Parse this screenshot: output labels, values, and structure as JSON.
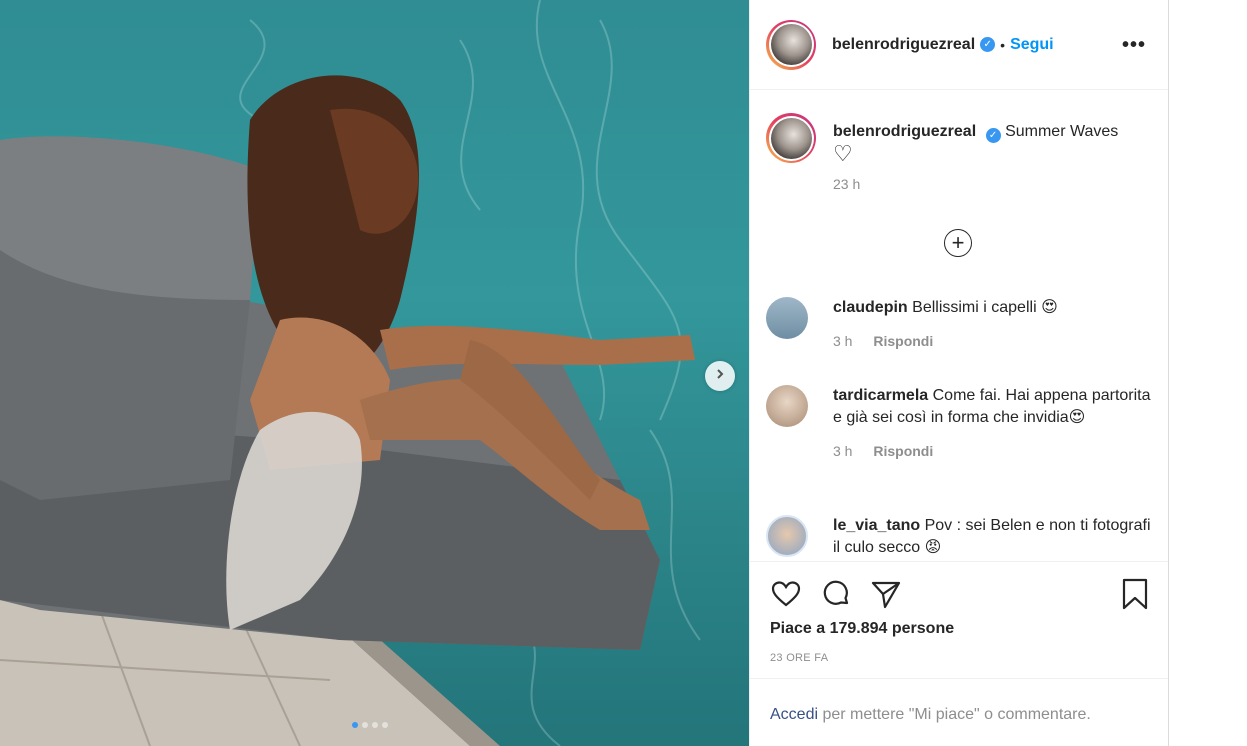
{
  "post": {
    "username": "belenrodriguezreal",
    "follow_label": "Segui",
    "separator": "•",
    "more_label": "•••",
    "verified_label": "✓",
    "caption_text": "Summer Waves",
    "caption_heart": "♡",
    "caption_time": "23 h",
    "load_more_label": "+",
    "next_label": "›",
    "carousel_pages": 4,
    "carousel_active": 1
  },
  "comments": [
    {
      "username": "claudepin",
      "text": "Bellissimi i capelli 😍",
      "time": "3 h",
      "reply": "Rispondi"
    },
    {
      "username": "tardicarmela",
      "text": "Come fai. Hai appena partorita e già sei così in forma che invidia😍",
      "time": "3 h",
      "reply": "Rispondi"
    },
    {
      "username": "le_via_tano",
      "text": "Pov : sei Belen e non ti fotografi il culo secco 😡",
      "time": "",
      "reply": ""
    }
  ],
  "actions": {
    "likes_text": "Piace a 179.894 persone",
    "time_ago": "23 ORE FA"
  },
  "login": {
    "link_label": "Accedi",
    "rest_text": " per mettere \"Mi piace\" o commentare."
  },
  "icons": [
    "heart-icon",
    "comment-icon",
    "share-icon",
    "bookmark-icon",
    "chevron-right-icon",
    "plus-circle-icon",
    "verified-icon",
    "more-icon"
  ],
  "colors": {
    "accent": "#0095f6",
    "pool": "#2f8d93",
    "muted": "#8e8e8e"
  }
}
